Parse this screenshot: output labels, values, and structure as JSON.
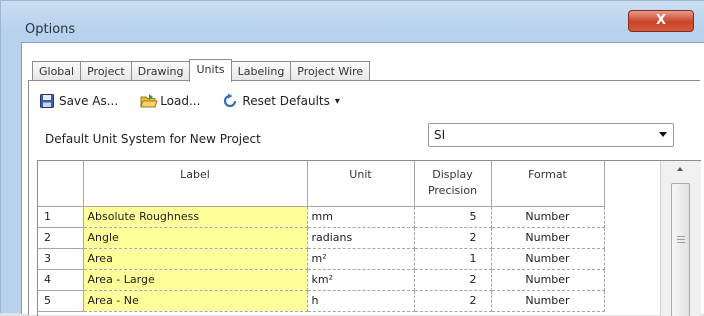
{
  "window": {
    "title": "Options",
    "close_symbol": "X"
  },
  "tabs": [
    {
      "label": "Global",
      "active": false
    },
    {
      "label": "Project",
      "active": false
    },
    {
      "label": "Drawing",
      "active": false
    },
    {
      "label": "Units",
      "active": true
    },
    {
      "label": "Labeling",
      "active": false
    },
    {
      "label": "Project Wire",
      "active": false
    }
  ],
  "toolbar": {
    "save_as_label": "Save As...",
    "load_label": "Load...",
    "reset_label": "Reset Defaults",
    "reset_arrow": "▾"
  },
  "unit_system": {
    "label": "Default Unit System for New Project",
    "value": "SI"
  },
  "grid": {
    "headers": {
      "num": "",
      "label": "Label",
      "unit": "Unit",
      "precision_line1": "Display",
      "precision_line2": "Precision",
      "format": "Format"
    },
    "rows": [
      {
        "num": "1",
        "label": "Absolute Roughness",
        "unit": "mm",
        "precision": "5",
        "format": "Number"
      },
      {
        "num": "2",
        "label": "Angle",
        "unit": "radians",
        "precision": "2",
        "format": "Number"
      },
      {
        "num": "3",
        "label": "Area",
        "unit": "m²",
        "precision": "1",
        "format": "Number"
      },
      {
        "num": "4",
        "label": "Area - Large",
        "unit": "km²",
        "precision": "2",
        "format": "Number"
      },
      {
        "num": "5",
        "label": "Area - Ne",
        "unit": "h",
        "precision": "2",
        "format": "Number"
      }
    ]
  },
  "colors": {
    "title_bar": "#c9dff3",
    "close_button": "#c9442a",
    "label_cell_background": "#ffff99"
  }
}
